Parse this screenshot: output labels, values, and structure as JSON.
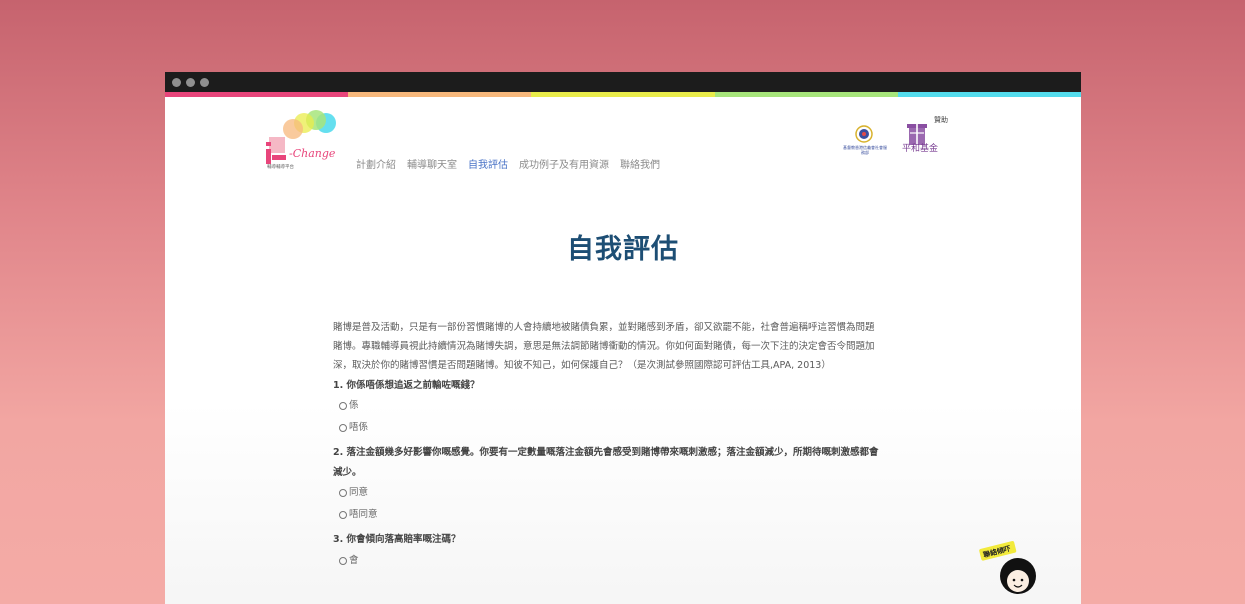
{
  "colors": {
    "accent_nav": "#4b74c7",
    "title": "#1d4e74",
    "strip": [
      "#e8457b",
      "#f7b87c",
      "#e9ec4b",
      "#a7e57b",
      "#54dced"
    ]
  },
  "window": {
    "controls": [
      "close",
      "minimize",
      "maximize"
    ]
  },
  "logo": {
    "wordmark": "i-Change",
    "subtitle": "輔導輔導平台"
  },
  "nav": {
    "items": [
      {
        "label": "計劃介紹"
      },
      {
        "label": "輔導聊天室"
      },
      {
        "label": "自我評估"
      },
      {
        "label": "成功例子及有用資源"
      },
      {
        "label": "聯絡我們"
      }
    ],
    "active_index": 2
  },
  "sponsor": {
    "label": "贊助",
    "org_name": "平和基金",
    "partner_org": "基督教香港信義會社會服務部"
  },
  "page": {
    "title": "自我評估",
    "intro": "賭博是普及活動，只是有一部份習慣賭博的人會持續地被賭債負累，並對賭感到矛盾，卻又欲罷不能，社會普遍稱呼這習慣為問題賭博。專職輔導員視此持續情況為賭博失調，意思是無法調節賭博衝動的情況。你如何面對賭債，每一次下注的決定會否令問題加深，取決於你的賭博習慣是否問題賭博。知彼不知己，如何保護自己？（是次測試參照國際認可評估工具,APA, 2013）"
  },
  "questions": [
    {
      "text": "1. 你係唔係想追返之前輸咗嘅錢？",
      "options": [
        "係",
        "唔係"
      ]
    },
    {
      "text": "2. 落注金額幾多好影響你嘅感覺。你要有一定數量嘅落注金額先會感受到賭博帶來嘅刺激感；落注金額減少，所期待嘅刺激感都會減少。",
      "options": [
        "同意",
        "唔同意"
      ]
    },
    {
      "text": "3. 你會傾向落高賠率嘅注碼？",
      "options": [
        "會"
      ]
    }
  ],
  "chat_widget": {
    "label": "聯絡傾吓"
  }
}
